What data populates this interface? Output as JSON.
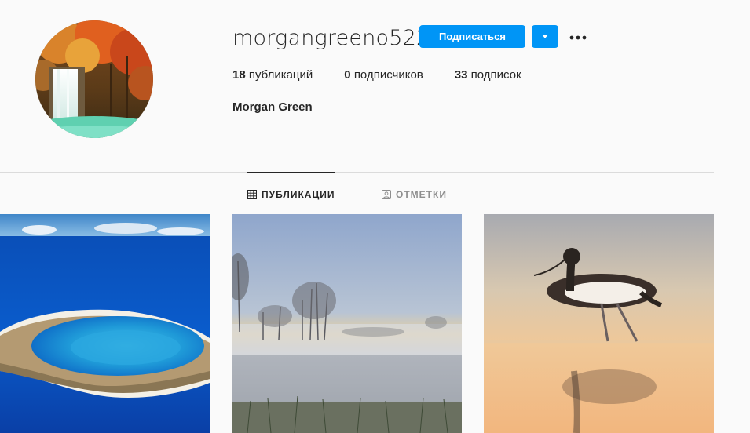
{
  "profile": {
    "username": "morgangreeno522",
    "full_name": "Morgan Green",
    "avatar_icon": "waterfall-avatar"
  },
  "actions": {
    "follow_label": "Подписаться",
    "dropdown_icon": "chevron-down-icon",
    "more_icon": "more-horizontal-icon"
  },
  "stats": {
    "posts_count": "18",
    "posts_label": "публикаций",
    "followers_count": "0",
    "followers_label": "подписчиков",
    "following_count": "33",
    "following_label": "подписок"
  },
  "tabs": [
    {
      "label": "ПУБЛИКАЦИИ",
      "icon": "grid-icon",
      "active": true
    },
    {
      "label": "ОТМЕТКИ",
      "icon": "tagged-icon",
      "active": false
    }
  ],
  "posts": [
    {
      "subject": "atoll-island-photo"
    },
    {
      "subject": "misty-lake-photo"
    },
    {
      "subject": "avocet-bird-photo"
    }
  ],
  "colors": {
    "accent": "#0095f6",
    "background": "#fafafa",
    "text": "#262626",
    "muted": "#8e8e8e",
    "border": "#dbdbdb"
  }
}
